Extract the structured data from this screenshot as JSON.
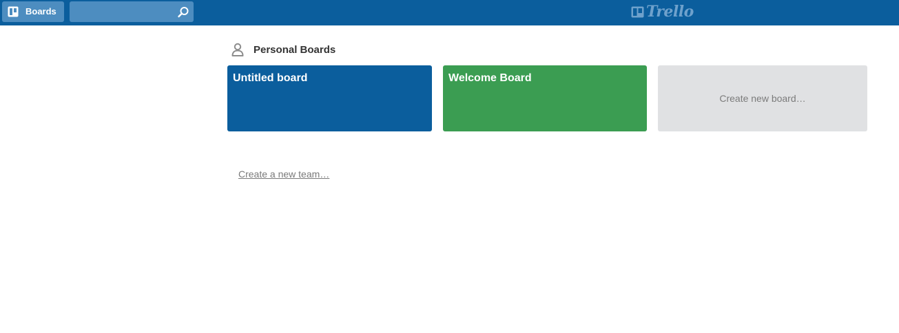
{
  "header": {
    "boards_label": "Boards",
    "search": {
      "value": "",
      "placeholder": ""
    },
    "logo_text": "Trello"
  },
  "personal_boards": {
    "title": "Personal Boards",
    "boards": [
      {
        "name": "Untitled board",
        "color": "#0b5e9d"
      },
      {
        "name": "Welcome Board",
        "color": "#3b9d52"
      }
    ],
    "create_label": "Create new board…"
  },
  "create_team_label": "Create a new team…",
  "icons": {
    "boards": "boards-icon",
    "search": "search-icon",
    "logo": "trello-logo-icon",
    "person": "person-icon"
  },
  "colors": {
    "header": "#0b5e9d",
    "header_button": "#4d8dc0",
    "create_tile": "#e0e1e3"
  }
}
